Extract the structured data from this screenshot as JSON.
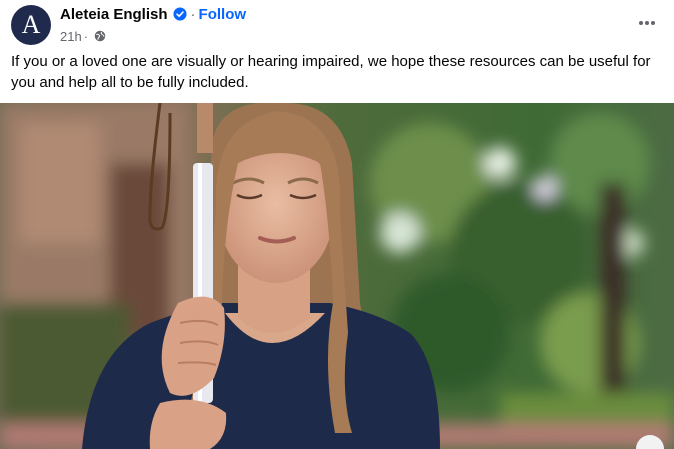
{
  "post": {
    "page_name": "Aleteia English",
    "avatar_letter": "A",
    "verified_icon": "verified-badge-icon",
    "separator": "·",
    "follow_label": "Follow",
    "timestamp": "21h",
    "privacy_icon": "globe-icon",
    "more_icon": "more-options-icon",
    "text": "If you or a loved one are visually or hearing impaired, we hope these resources can be useful for you and help all to be fully included.",
    "image_subject": "photo-woman-with-white-cane"
  },
  "colors": {
    "avatar_bg": "#1f2a4d",
    "follow": "#0866ff",
    "verified": "#0866ff",
    "meta_text": "#65676b"
  }
}
